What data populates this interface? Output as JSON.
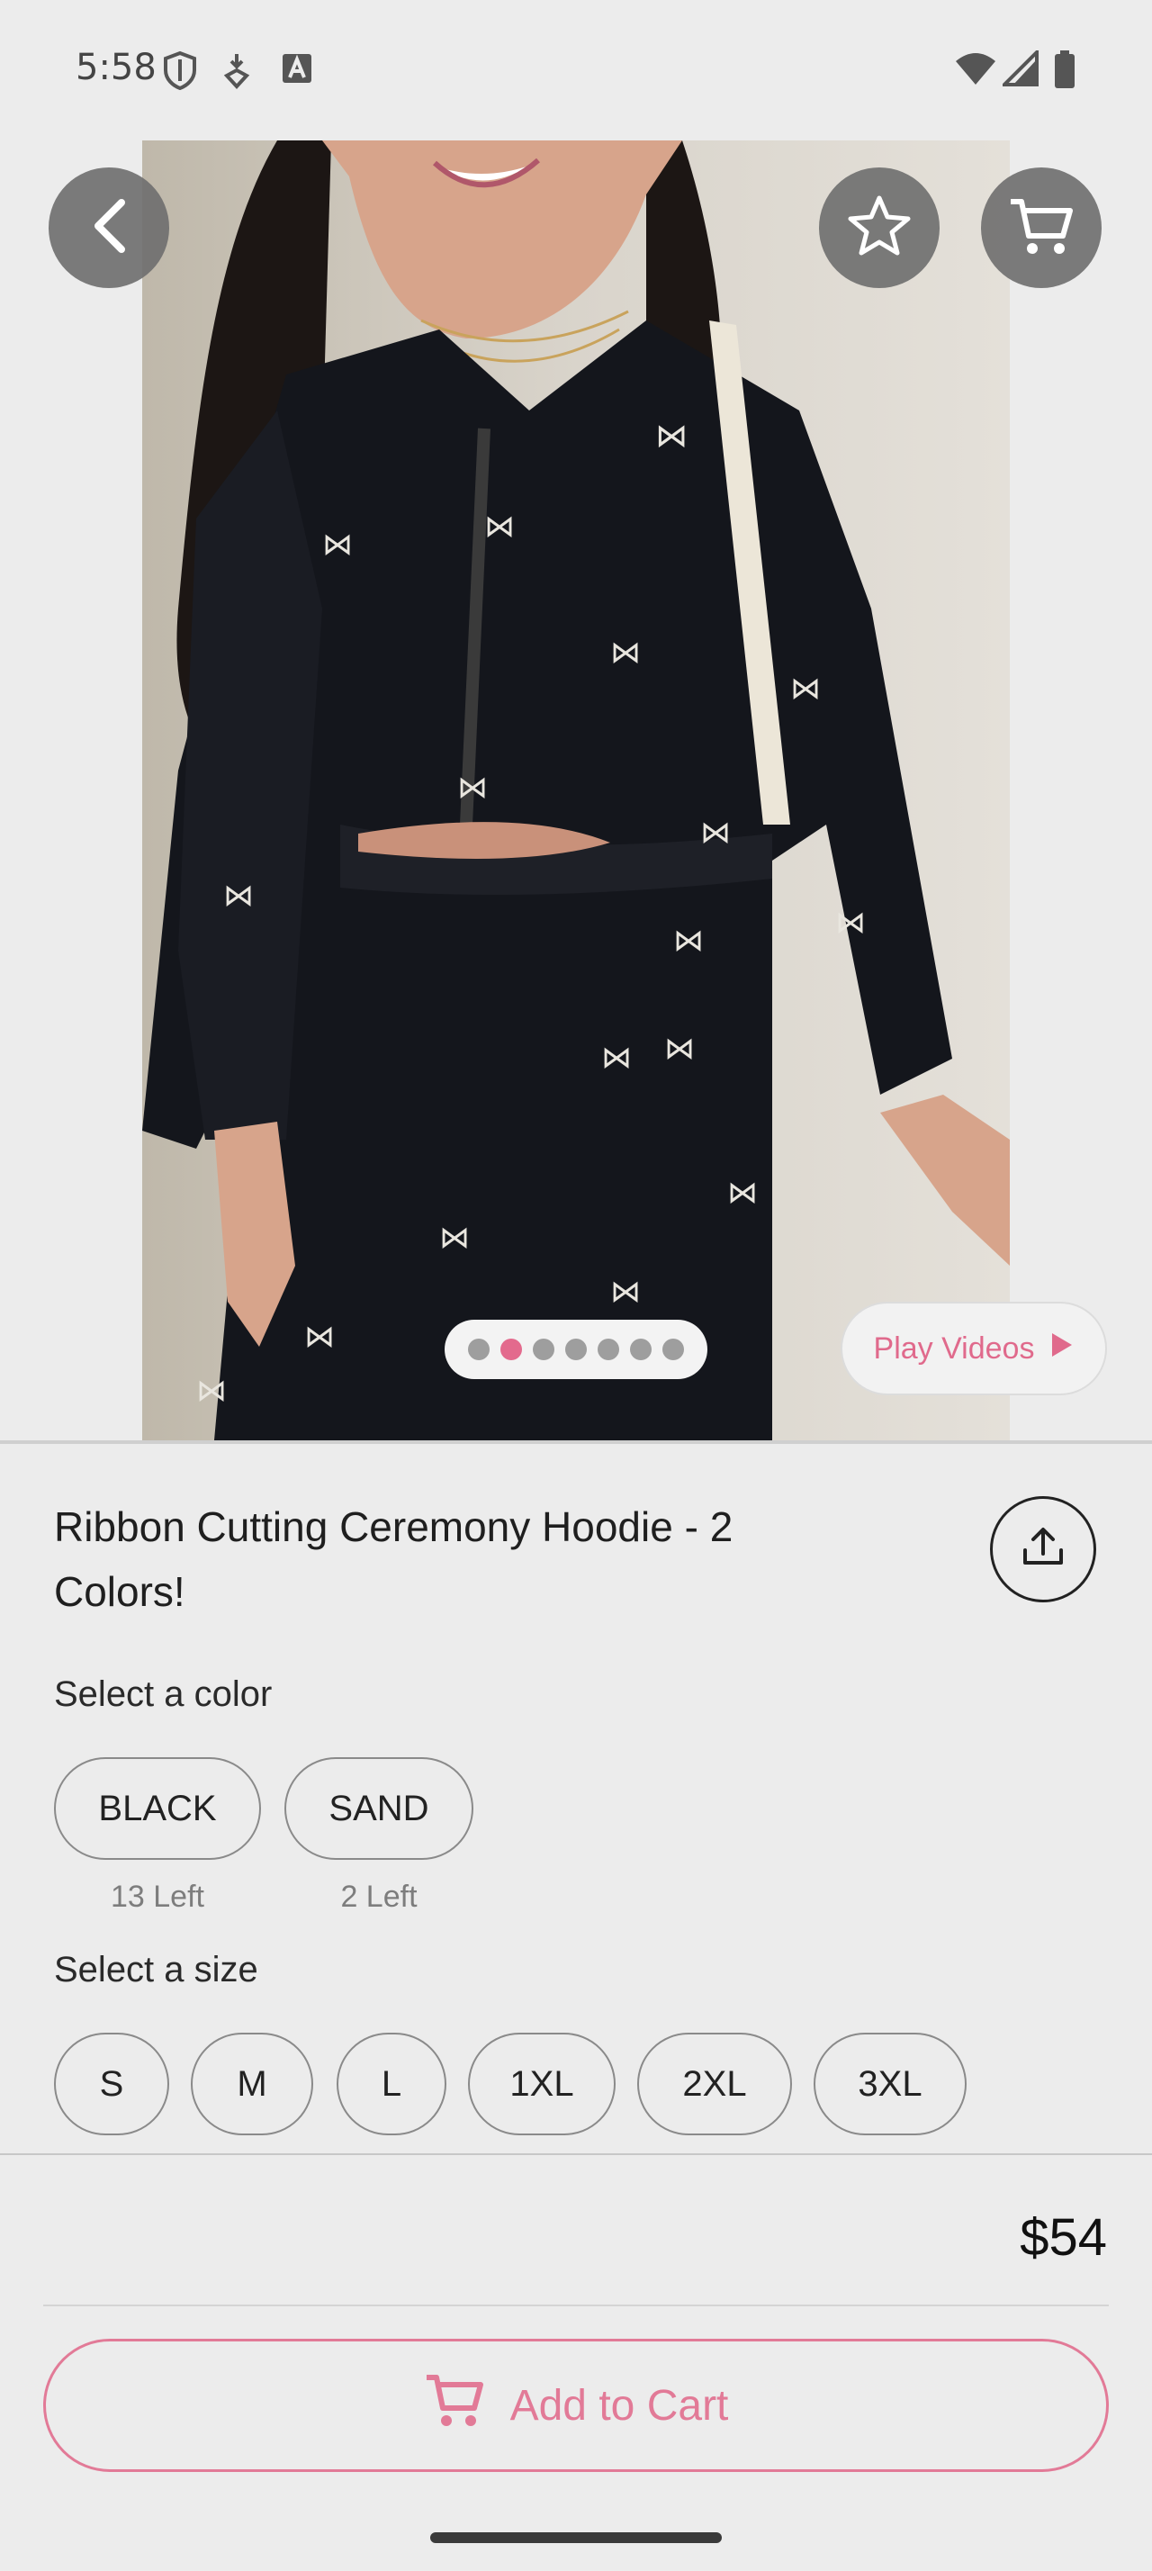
{
  "status_bar": {
    "time": "5:58",
    "left_icons": [
      "shield-icon",
      "location-download-icon",
      "font-a-icon"
    ],
    "right_icons": [
      "wifi-icon",
      "signal-icon",
      "battery-icon"
    ]
  },
  "hero": {
    "image_description_icon": "product-photo",
    "carousel": {
      "count": 7,
      "active_index": 1
    },
    "play_videos_label": "Play Videos"
  },
  "product": {
    "title": "Ribbon Cutting Ceremony Hoodie - 2 Colors!",
    "color_label": "Select a color",
    "colors": [
      {
        "name": "BLACK",
        "stock": "13 Left"
      },
      {
        "name": "SAND",
        "stock": "2 Left"
      }
    ],
    "size_label": "Select a size",
    "sizes": [
      "S",
      "M",
      "L",
      "1XL",
      "2XL",
      "3XL"
    ],
    "price": "$54"
  },
  "actions": {
    "add_to_cart": "Add to Cart"
  },
  "colors": {
    "accent": "#e27a97",
    "active_dot": "#e36a8d"
  }
}
